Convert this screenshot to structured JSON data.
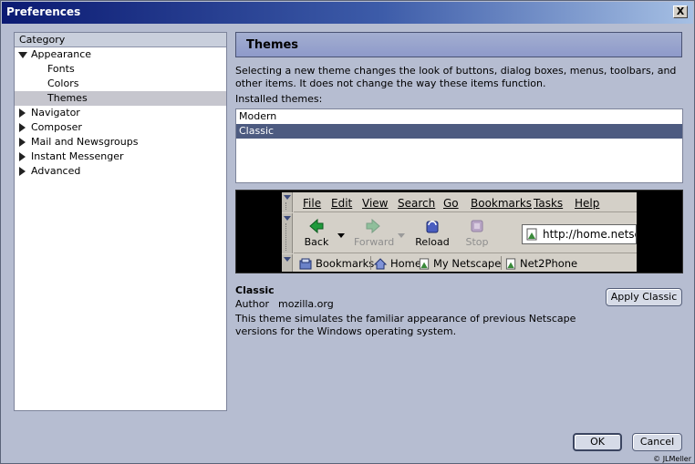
{
  "window": {
    "title": "Preferences",
    "close_label": "X"
  },
  "category_panel": {
    "header": "Category",
    "items": [
      {
        "label": "Appearance",
        "expanded": true,
        "level": 0
      },
      {
        "label": "Fonts",
        "level": 1
      },
      {
        "label": "Colors",
        "level": 1
      },
      {
        "label": "Themes",
        "level": 1,
        "selected": true
      },
      {
        "label": "Navigator",
        "expanded": false,
        "level": 0
      },
      {
        "label": "Composer",
        "expanded": false,
        "level": 0
      },
      {
        "label": "Mail and Newsgroups",
        "expanded": false,
        "level": 0
      },
      {
        "label": "Instant Messenger",
        "expanded": false,
        "level": 0
      },
      {
        "label": "Advanced",
        "expanded": false,
        "level": 0
      }
    ]
  },
  "main": {
    "header": "Themes",
    "description": "Selecting a new theme changes the look of buttons, dialog boxes, menus, toolbars, and other items. It does not change the way these items function.",
    "installed_label": "Installed themes:",
    "themes": [
      {
        "name": "Modern",
        "selected": false
      },
      {
        "name": "Classic",
        "selected": true
      }
    ],
    "preview": {
      "menu": [
        "File",
        "Edit",
        "View",
        "Search",
        "Go",
        "Bookmarks",
        "Tasks",
        "Help"
      ],
      "nav_buttons": [
        {
          "label": "Back",
          "enabled": true
        },
        {
          "label": "Forward",
          "enabled": false
        },
        {
          "label": "Reload",
          "enabled": true
        },
        {
          "label": "Stop",
          "enabled": false
        }
      ],
      "url": "http://home.netscape",
      "personal_toolbar": [
        "Bookmarks",
        "Home",
        "My Netscape",
        "Net2Phone"
      ]
    },
    "selected_theme": {
      "name": "Classic",
      "author_label": "Author",
      "author": "mozilla.org",
      "description": "This theme simulates the familiar appearance of previous Netscape versions for the Windows operating system."
    },
    "apply_button": "Apply Classic"
  },
  "footer": {
    "ok": "OK",
    "cancel": "Cancel",
    "credit": "© JLMeller"
  },
  "colors": {
    "title_bar_start": "#0b1a72",
    "selected_theme_row": "#4d5b80",
    "window_bg": "#b6bdd1"
  }
}
